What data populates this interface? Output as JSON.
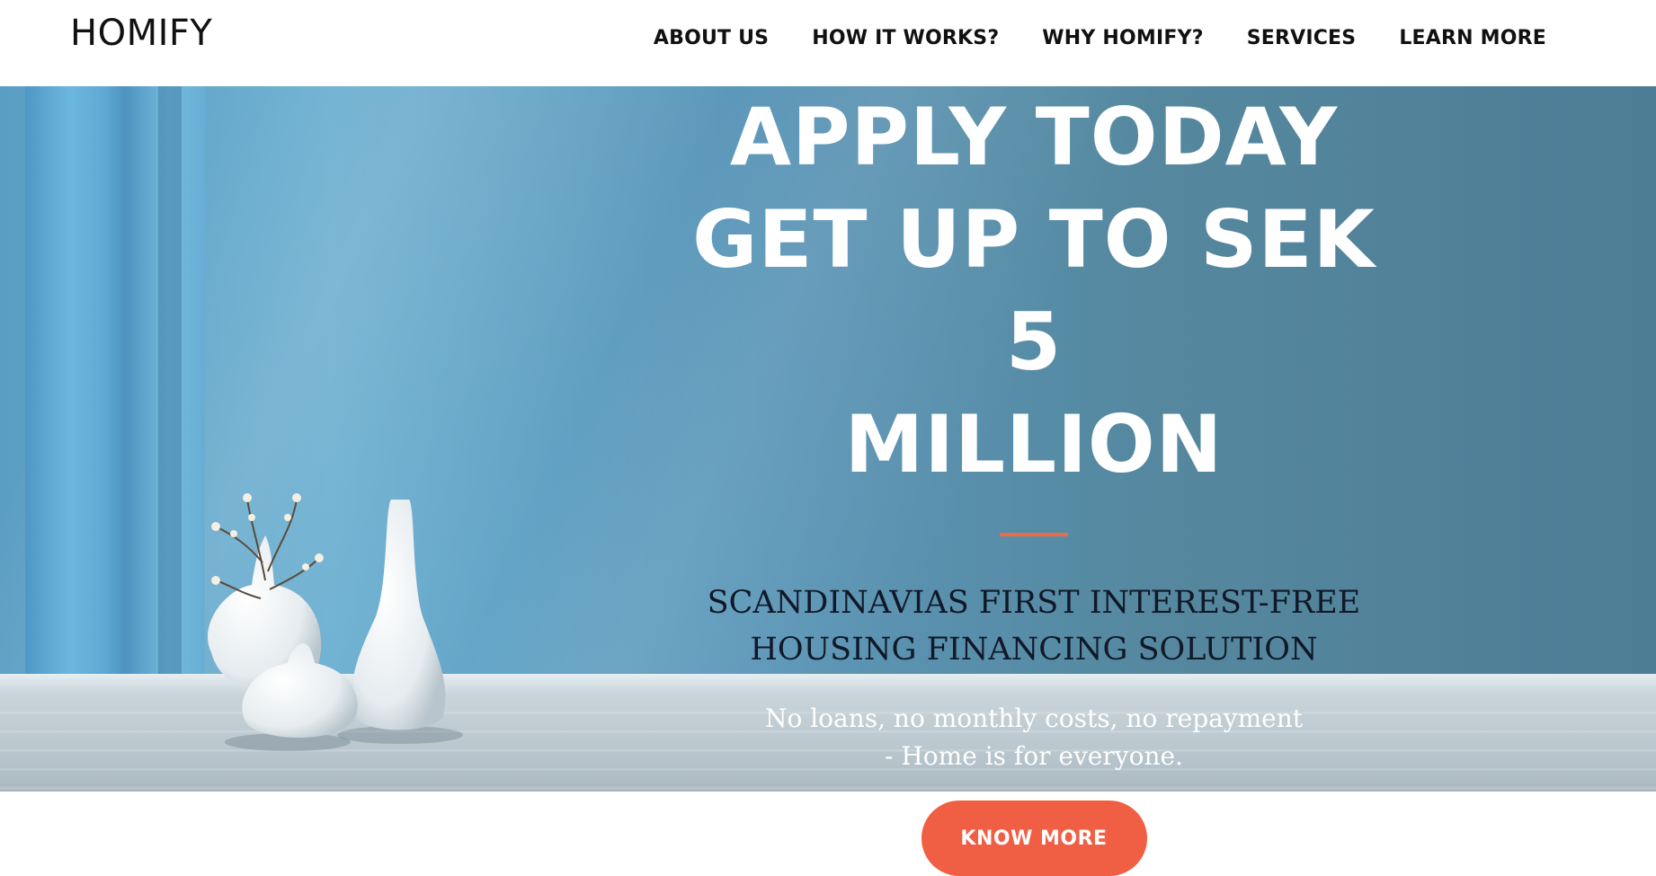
{
  "header": {
    "brand": "HOMIFY",
    "nav": [
      {
        "label": "ABOUT US"
      },
      {
        "label": "HOW IT WORKS?"
      },
      {
        "label": "WHY HOMIFY?"
      },
      {
        "label": "SERVICES"
      },
      {
        "label": "LEARN MORE"
      }
    ]
  },
  "hero": {
    "headline_lines": [
      "APPLY TODAY",
      "GET UP TO SEK 5",
      "MILLION"
    ],
    "subheadline_lines": [
      "SCANDINAVIAS FIRST INTEREST-FREE",
      "HOUSING FINANCING SOLUTION"
    ],
    "tagline_lines": [
      "No loans, no monthly costs, no repayment",
      "- Home is for everyone."
    ],
    "cta_label": "KNOW MORE"
  },
  "colors": {
    "accent": "#f05f43",
    "hero_background": "#5b93b5",
    "nav_text": "#111111"
  }
}
